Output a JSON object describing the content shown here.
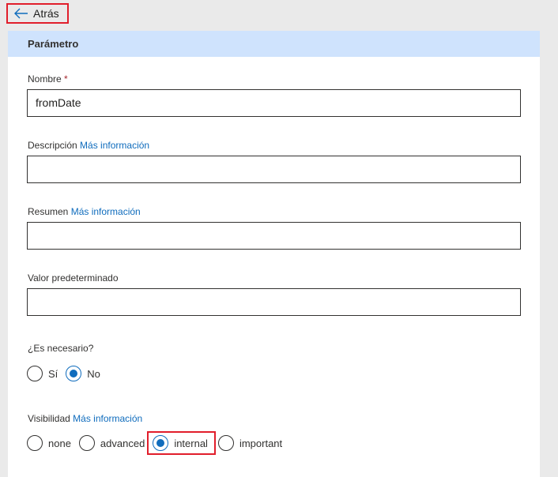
{
  "back": {
    "label": "Atrás",
    "icon": "arrow-left-icon"
  },
  "panel": {
    "title": "Parámetro"
  },
  "fields": {
    "name": {
      "label": "Nombre",
      "required_mark": "*",
      "value": "fromDate"
    },
    "description": {
      "label": "Descripción",
      "link": "Más información",
      "value": ""
    },
    "summary": {
      "label": "Resumen",
      "link": "Más información",
      "value": ""
    },
    "default": {
      "label": "Valor predeterminado",
      "value": ""
    }
  },
  "required": {
    "label": "¿Es necesario?",
    "options": [
      "Sí",
      "No"
    ],
    "selected": "No"
  },
  "visibility": {
    "label": "Visibilidad",
    "link": "Más información",
    "options": [
      "none",
      "advanced",
      "internal",
      "important"
    ],
    "selected": "internal"
  },
  "colors": {
    "accent": "#0f6cbd",
    "header_bg": "#cfe3fd",
    "highlight": "#e11e2b"
  }
}
